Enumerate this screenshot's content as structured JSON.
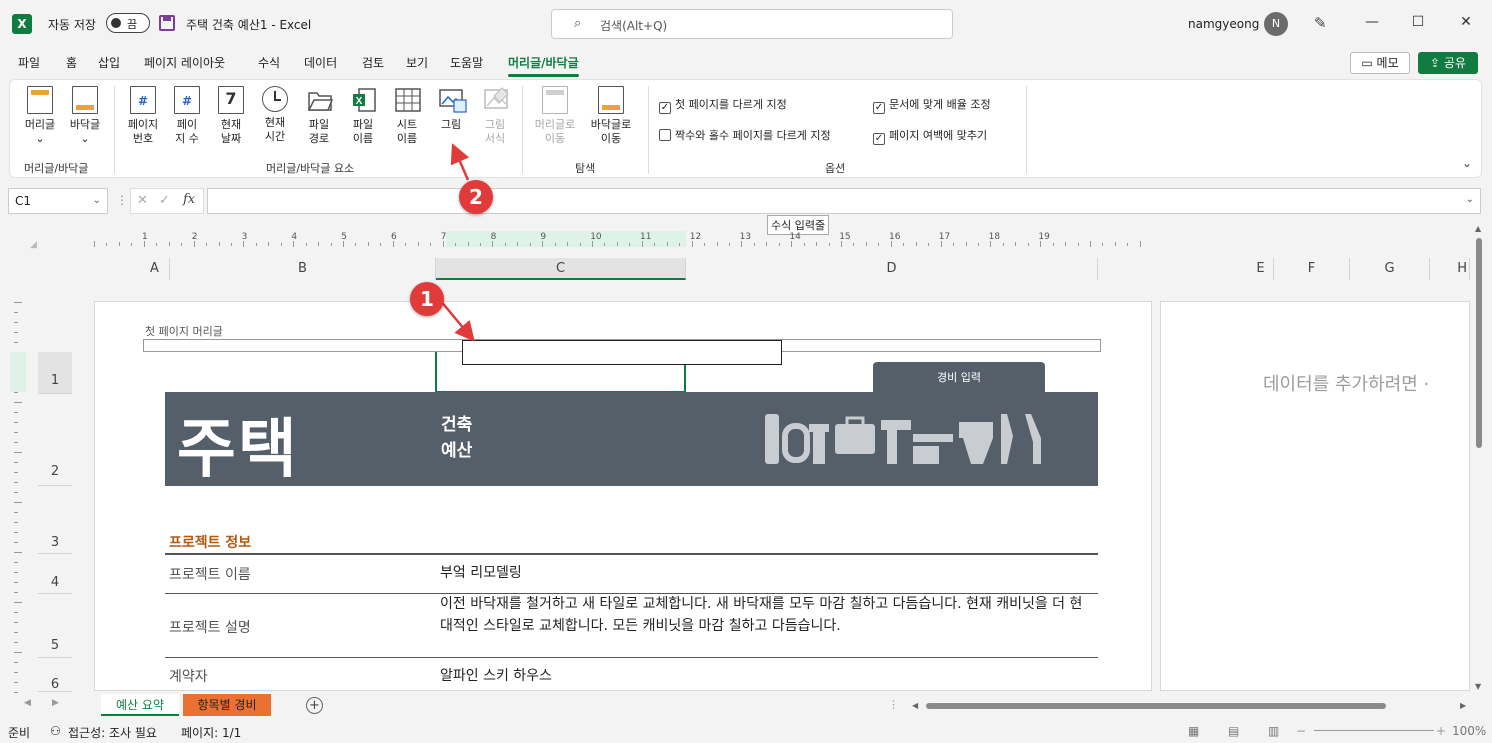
{
  "titlebar": {
    "app_logo": "X",
    "autosave_label": "자동 저장",
    "autosave_state": "끔",
    "doc_title": "주택 건축 예산1  -  Excel",
    "search_placeholder": "검색(Alt+Q)",
    "username": "namgyeong",
    "avatar_initial": "N"
  },
  "menu": {
    "tabs": [
      "파일",
      "홈",
      "삽입",
      "페이지 레이아웃",
      "수식",
      "데이터",
      "검토",
      "보기",
      "도움말",
      "머리글/바닥글"
    ],
    "active_tab": "머리글/바닥글",
    "memo_label": "메모",
    "share_label": "공유"
  },
  "ribbon": {
    "buttons": [
      {
        "l1": "머리글",
        "l2": "⌄"
      },
      {
        "l1": "바닥글",
        "l2": "⌄"
      },
      {
        "l1": "페이지",
        "l2": "번호"
      },
      {
        "l1": "페이",
        "l2": "지 수"
      },
      {
        "l1": "현재",
        "l2": "날짜"
      },
      {
        "l1": "현재",
        "l2": "시간"
      },
      {
        "l1": "파일",
        "l2": "경로"
      },
      {
        "l1": "파일",
        "l2": "이름"
      },
      {
        "l1": "시트",
        "l2": "이름"
      },
      {
        "l1": "그림",
        "l2": ""
      },
      {
        "l1": "그림",
        "l2": "서식"
      },
      {
        "l1": "머리글로",
        "l2": "이동"
      },
      {
        "l1": "바닥글로",
        "l2": "이동"
      }
    ],
    "glyphs": {
      "page_number": "#",
      "page_count": "#",
      "date_number": "7"
    },
    "groups": [
      "머리글/바닥글",
      "머리글/바닥글 요소",
      "탐색",
      "옵션"
    ],
    "options": [
      {
        "label": "첫 페이지를 다르게 지정",
        "checked": true
      },
      {
        "label": "짝수와 홀수 페이지를 다르게 지정",
        "checked": false
      },
      {
        "label": "문서에 맞게 배율 조정",
        "checked": true
      },
      {
        "label": "페이지 여백에 맞추기",
        "checked": true
      }
    ]
  },
  "formula_bar": {
    "name_box": "C1",
    "fx": "fx",
    "tooltip": "수식 입력줄"
  },
  "ruler_numbers": [
    "1",
    "2",
    "3",
    "4",
    "5",
    "6",
    "7",
    "8",
    "9",
    "10",
    "11",
    "12",
    "13",
    "14",
    "15",
    "16",
    "17",
    "18",
    "19"
  ],
  "columns": [
    "A",
    "B",
    "C",
    "D",
    "E",
    "F",
    "G",
    "H"
  ],
  "rows": [
    "1",
    "2",
    "3",
    "4",
    "5",
    "6"
  ],
  "page": {
    "first_header_label": "첫 페이지 머리글",
    "expense_tab": "경비 입력",
    "banner_big": "주택",
    "banner_sub1": "건축",
    "banner_sub2": "예산",
    "section_title": "프로젝트 정보",
    "rows": [
      {
        "label": "프로젝트 이름",
        "value": "부엌 리모델링"
      },
      {
        "label": "프로젝트 설명",
        "value": "이전 바닥재를 철거하고 새 타일로 교체합니다.  새 바닥재를 모두 마감 칠하고 다듬습니다.  현재 캐비닛을 더 현대적인 스타일로 교체합니다.  모든 캐비닛을 마감 칠하고 다듬습니다."
      },
      {
        "label": "계약자",
        "value": "알파인 스키 하우스"
      }
    ],
    "side_hint": "데이터를 추가하려면 ·"
  },
  "sheets": [
    {
      "name": "예산 요약",
      "active": true
    },
    {
      "name": "항목별 경비",
      "color": "#e97132"
    }
  ],
  "add_sheet_symbol": "+",
  "status": {
    "ready": "준비",
    "accessibility": "접근성: 조사 필요",
    "page": "페이지: 1/1",
    "zoom": "100%"
  },
  "annotations": [
    "1",
    "2"
  ],
  "colors": {
    "accent": "#107c41",
    "banner": "#545f6a",
    "section_title": "#b05a12",
    "badge": "#e03a3a",
    "orange_tab": "#e97132"
  }
}
